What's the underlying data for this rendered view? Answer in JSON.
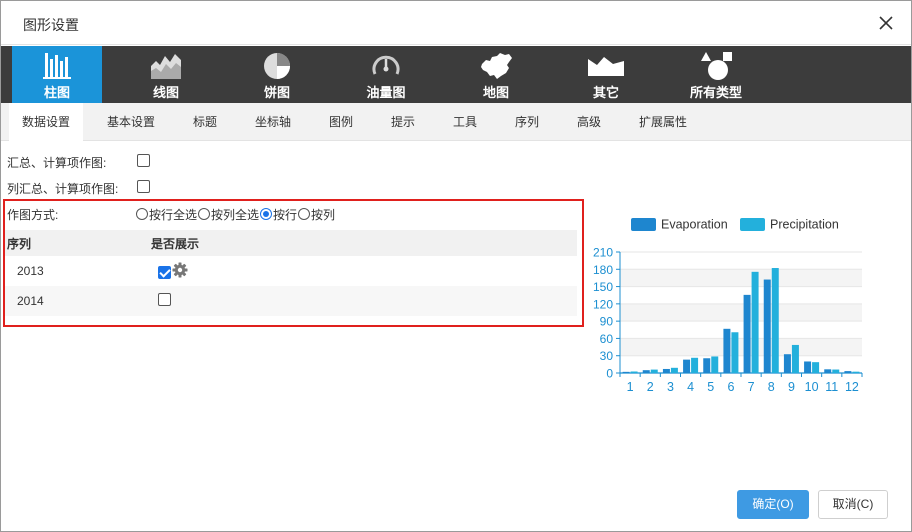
{
  "dialog": {
    "title": "图形设置"
  },
  "chart_types": [
    {
      "label": "柱图",
      "icon": "bar-chart-icon",
      "active": true
    },
    {
      "label": "线图",
      "icon": "line-chart-icon",
      "active": false
    },
    {
      "label": "饼图",
      "icon": "pie-chart-icon",
      "active": false
    },
    {
      "label": "油量图",
      "icon": "gauge-chart-icon",
      "active": false
    },
    {
      "label": "地图",
      "icon": "map-china-icon",
      "active": false
    },
    {
      "label": "其它",
      "icon": "other-chart-icon",
      "active": false
    },
    {
      "label": "所有类型",
      "icon": "all-types-icon",
      "active": false
    }
  ],
  "tabs": [
    {
      "label": "数据设置",
      "active": true
    },
    {
      "label": "基本设置",
      "active": false
    },
    {
      "label": "标题",
      "active": false
    },
    {
      "label": "坐标轴",
      "active": false
    },
    {
      "label": "图例",
      "active": false
    },
    {
      "label": "提示",
      "active": false
    },
    {
      "label": "工具",
      "active": false
    },
    {
      "label": "序列",
      "active": false
    },
    {
      "label": "高级",
      "active": false
    },
    {
      "label": "扩展属性",
      "active": false
    }
  ],
  "options": {
    "summary_plot_label": "汇总、计算项作图:",
    "summary_plot_checked": false,
    "column_summary_plot_label": "列汇总、计算项作图:",
    "column_summary_plot_checked": false,
    "plot_mode_label": "作图方式:",
    "plot_mode_options": [
      "按行全选",
      "按列全选",
      "按行",
      "按列"
    ],
    "plot_mode_selected": "按行"
  },
  "series_table": {
    "headers": [
      "序列",
      "是否展示"
    ],
    "rows": [
      {
        "name": "2013",
        "show": true
      },
      {
        "name": "2014",
        "show": false
      }
    ]
  },
  "chart_data": {
    "type": "bar",
    "categories": [
      "1",
      "2",
      "3",
      "4",
      "5",
      "6",
      "7",
      "8",
      "9",
      "10",
      "11",
      "12"
    ],
    "series": [
      {
        "name": "Evaporation",
        "color": "#1e86cf",
        "values": [
          2.0,
          4.9,
          7.0,
          23.2,
          25.6,
          76.7,
          135.6,
          162.2,
          32.6,
          20.0,
          6.4,
          3.3
        ]
      },
      {
        "name": "Precipitation",
        "color": "#23b0dc",
        "values": [
          2.6,
          5.9,
          9.0,
          26.4,
          28.7,
          70.7,
          175.6,
          182.2,
          48.7,
          18.8,
          6.0,
          2.3
        ]
      }
    ],
    "ylim": [
      0,
      210
    ],
    "yticks": [
      0,
      30,
      60,
      90,
      120,
      150,
      180,
      210
    ],
    "legend_position": "top",
    "grid": true,
    "axis_color": "#1c8fd1"
  },
  "buttons": {
    "ok": "确定(O)",
    "cancel": "取消(C)"
  }
}
